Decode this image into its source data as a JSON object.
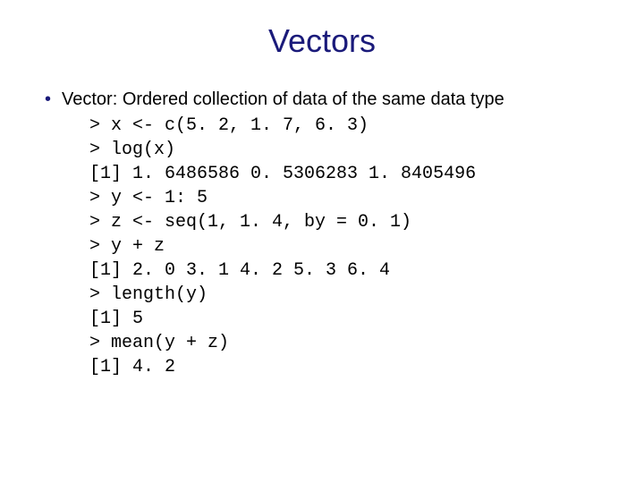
{
  "title": "Vectors",
  "bullet": {
    "marker": "•",
    "text": "Vector: Ordered collection of data of the same data type"
  },
  "code": {
    "lines": [
      "> x <- c(5. 2, 1. 7, 6. 3)",
      "> log(x)",
      "[1] 1. 6486586 0. 5306283 1. 8405496",
      "> y <- 1: 5",
      "> z <- seq(1, 1. 4, by = 0. 1)",
      "> y + z",
      "[1] 2. 0 3. 1 4. 2 5. 3 6. 4",
      "> length(y)",
      "[1] 5",
      "> mean(y + z)",
      "[1] 4. 2"
    ]
  }
}
